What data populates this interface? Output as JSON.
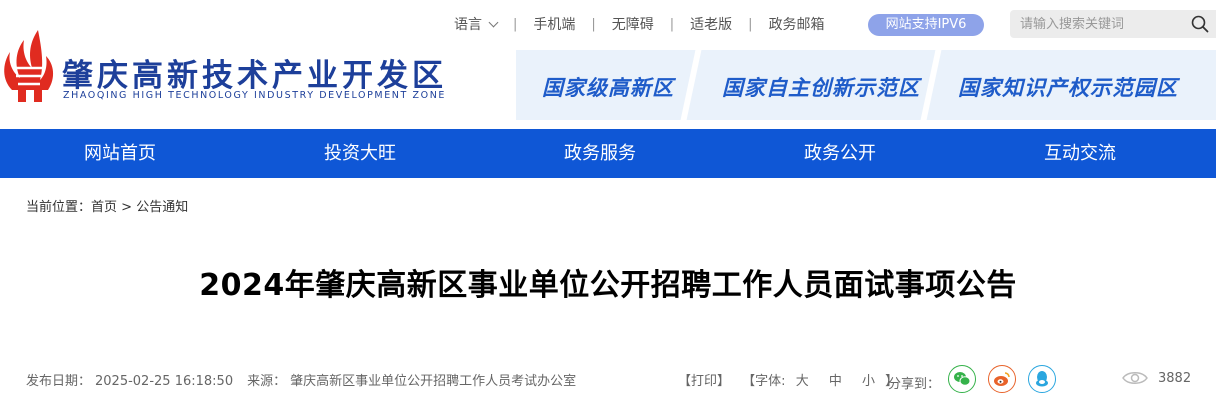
{
  "header": {
    "logo_cn": "肇庆高新技术产业开发区",
    "logo_en": "ZHAOQING HIGH TECHNOLOGY INDUSTRY DEVELOPMENT ZONE",
    "logo_color": "#1d3f9a",
    "logo_red": "#e02b20"
  },
  "topbar": {
    "language": "语言",
    "mobile": "手机端",
    "accessibility": "无障碍",
    "elderly": "适老版",
    "mail": "政务邮箱",
    "ipv6": "网站支持IPV6",
    "search_placeholder": "请输入搜索关键词",
    "search_icon": "search-icon"
  },
  "banner": {
    "tags": [
      "国家级高新区",
      "国家自主创新示范区",
      "国家知识产权示范园区"
    ]
  },
  "nav": {
    "items": [
      "网站首页",
      "投资大旺",
      "政务服务",
      "政务公开",
      "互动交流"
    ],
    "color": "#0f57d6"
  },
  "breadcrumb": {
    "prefix": "当前位置：",
    "home": "首页",
    "sep": ">",
    "current": "公告通知"
  },
  "article": {
    "title": "2024年肇庆高新区事业单位公开招聘工作人员面试事项公告",
    "date_label": "发布日期：",
    "date": "2025-02-25 16:18:50",
    "source_label": "来源：",
    "source": "肇庆高新区事业单位公开招聘工作人员考试办公室",
    "print": "【打印】",
    "font_label": "【字体:",
    "font_large": "大",
    "font_medium": "中",
    "font_small": "小",
    "font_close": "】",
    "share_label": "分享到：",
    "share_icons": [
      "wechat-icon",
      "weibo-icon",
      "qq-icon"
    ],
    "view_count": "3882"
  }
}
